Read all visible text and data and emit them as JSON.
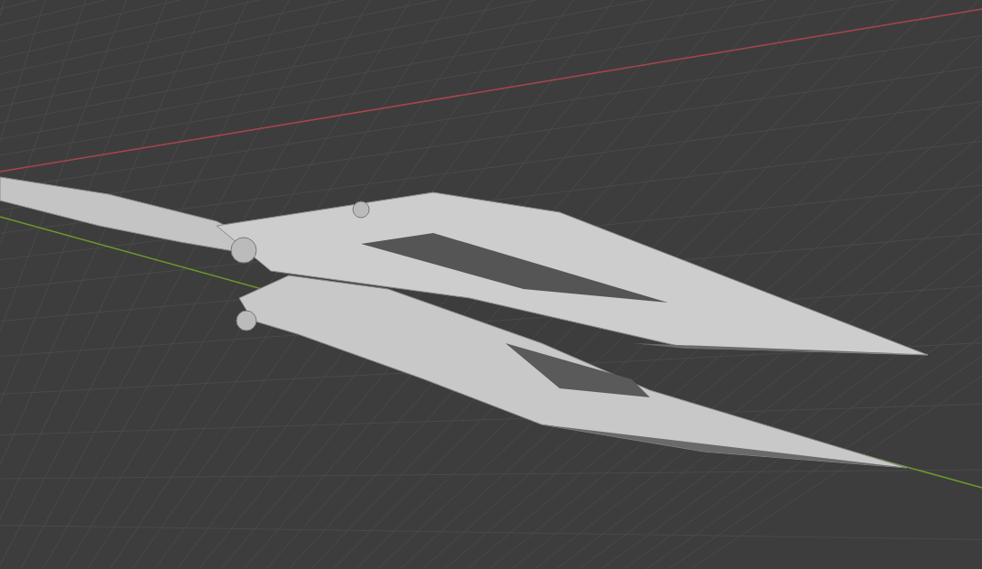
{
  "viewport": {
    "axes": [
      {
        "kind": "x",
        "color": "#a8454c"
      },
      {
        "kind": "y",
        "color": "#6b9a2c"
      }
    ]
  }
}
